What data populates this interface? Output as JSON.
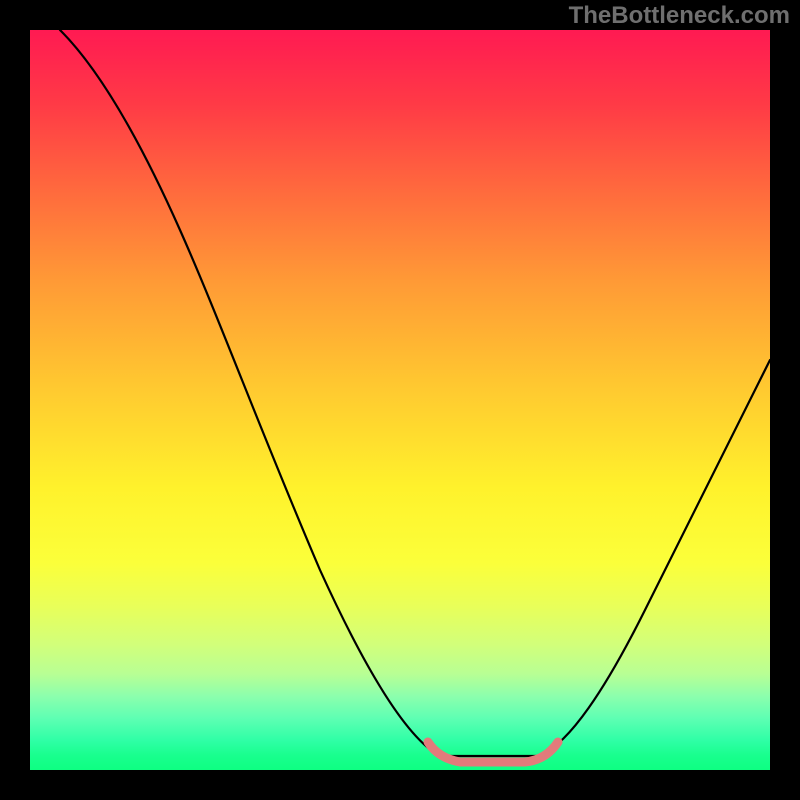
{
  "watermark": "TheBottleneck.com",
  "chart_data": {
    "type": "line",
    "title": "",
    "xlabel": "",
    "ylabel": "",
    "xlim": [
      0,
      100
    ],
    "ylim": [
      0,
      100
    ],
    "axes_visible": false,
    "grid": false,
    "legend": false,
    "background": "heat-gradient",
    "background_gradient_stops": [
      {
        "pos": 0,
        "color": "#ff1a52"
      },
      {
        "pos": 10,
        "color": "#ff3a46"
      },
      {
        "pos": 22,
        "color": "#ff6b3d"
      },
      {
        "pos": 34,
        "color": "#ff9a36"
      },
      {
        "pos": 48,
        "color": "#ffc830"
      },
      {
        "pos": 62,
        "color": "#fff22c"
      },
      {
        "pos": 72,
        "color": "#fbff3a"
      },
      {
        "pos": 78,
        "color": "#e8ff5a"
      },
      {
        "pos": 83,
        "color": "#d2ff7a"
      },
      {
        "pos": 87,
        "color": "#b8ff94"
      },
      {
        "pos": 90,
        "color": "#8cffad"
      },
      {
        "pos": 93,
        "color": "#5effb3"
      },
      {
        "pos": 96,
        "color": "#2fffa6"
      },
      {
        "pos": 98,
        "color": "#19ff8e"
      },
      {
        "pos": 100,
        "color": "#0eff82"
      }
    ],
    "series": [
      {
        "name": "main-curve",
        "color": "#000000",
        "x": [
          4,
          8,
          12,
          16,
          20,
          24,
          28,
          32,
          36,
          40,
          44,
          48,
          52,
          55,
          58,
          62,
          66,
          70,
          74,
          78,
          82,
          86,
          90,
          94,
          98,
          100
        ],
        "y": [
          100,
          97,
          91,
          84,
          76,
          68,
          60,
          52,
          44,
          36,
          28,
          20,
          12,
          6,
          2,
          0,
          0,
          2,
          6,
          12,
          20,
          28,
          36,
          44,
          52,
          56
        ]
      },
      {
        "name": "trough-highlight",
        "color": "#e27b7b",
        "x": [
          55,
          56,
          58,
          60,
          62,
          64,
          66,
          68,
          70
        ],
        "y": [
          6,
          3,
          1,
          0,
          0,
          0,
          0,
          1,
          3
        ]
      }
    ],
    "min_point": {
      "x": 63,
      "y": 0
    }
  }
}
